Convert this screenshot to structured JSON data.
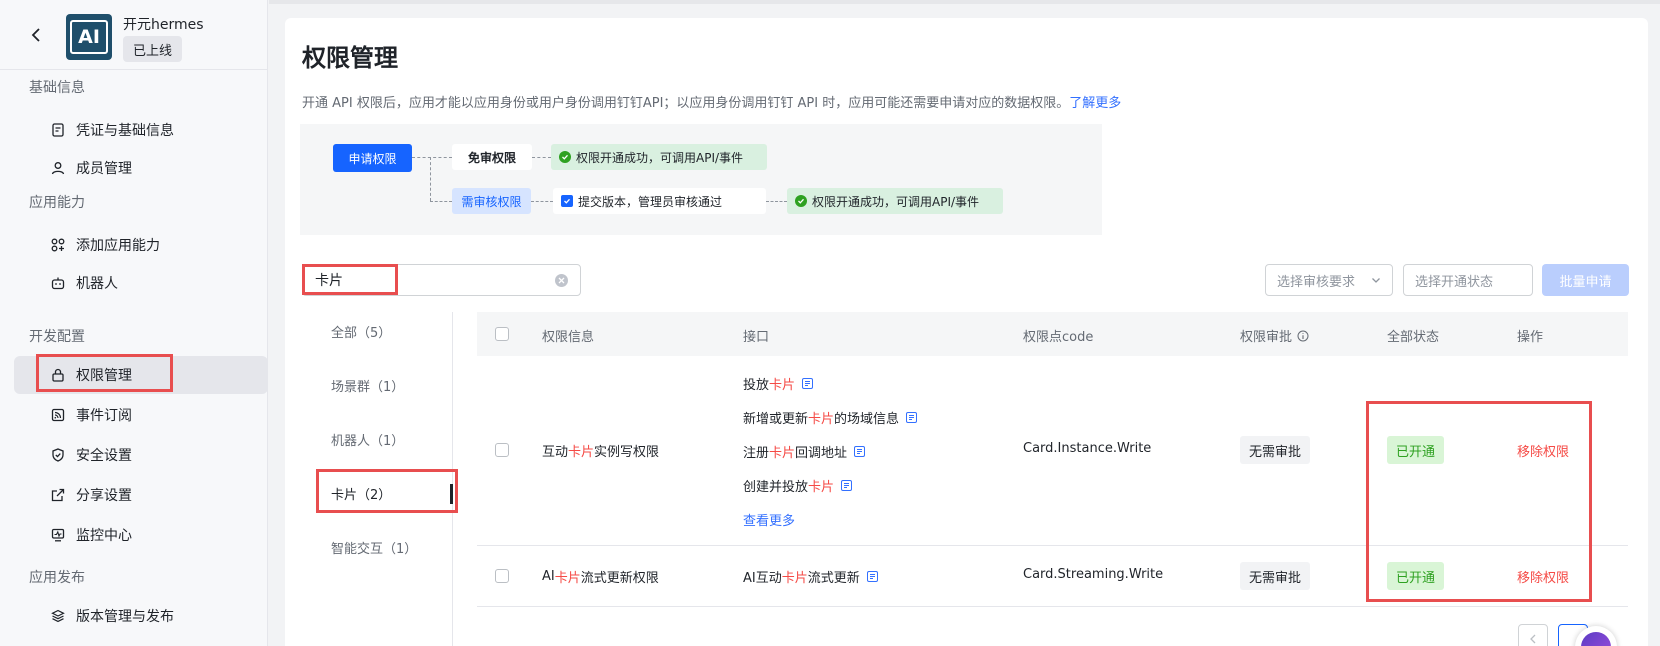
{
  "app": {
    "name": "开元hermes",
    "status": "已上线",
    "logo_text": "AI"
  },
  "sidebar": {
    "groups": [
      {
        "label": "基础信息",
        "items": [
          {
            "label": "凭证与基础信息",
            "icon": "credential-icon"
          },
          {
            "label": "成员管理",
            "icon": "user-icon"
          }
        ]
      },
      {
        "label": "应用能力",
        "items": [
          {
            "label": "添加应用能力",
            "icon": "add-capability-icon"
          },
          {
            "label": "机器人",
            "icon": "robot-icon"
          }
        ]
      },
      {
        "label": "开发配置",
        "items": [
          {
            "label": "权限管理",
            "icon": "lock-icon",
            "active": true
          },
          {
            "label": "事件订阅",
            "icon": "rss-icon"
          },
          {
            "label": "安全设置",
            "icon": "shield-icon"
          },
          {
            "label": "分享设置",
            "icon": "share-icon"
          },
          {
            "label": "监控中心",
            "icon": "monitor-icon"
          }
        ]
      },
      {
        "label": "应用发布",
        "items": [
          {
            "label": "版本管理与发布",
            "icon": "layers-icon"
          }
        ]
      }
    ]
  },
  "page": {
    "title": "权限管理",
    "description": "开通 API 权限后，应用才能以应用身份或用户身份调用钉钉API；以应用身份调用钉钉 API 时，应用可能还需要申请对应的数据权限。",
    "learn_more": "了解更多"
  },
  "flow": {
    "apply": "申请权限",
    "free": "免审权限",
    "review": "需审核权限",
    "success": "权限开通成功，可调用API/事件",
    "submit": "提交版本，管理员审核通过"
  },
  "toolbar": {
    "search_value": "卡片",
    "review_select_placeholder": "选择审核要求",
    "status_select_placeholder": "选择开通状态",
    "batch_apply": "批量申请"
  },
  "categories": [
    {
      "label": "全部（5）"
    },
    {
      "label": "场景群（1）"
    },
    {
      "label": "机器人（1）"
    },
    {
      "label": "卡片（2）",
      "active": true
    },
    {
      "label": "智能交互（1）"
    }
  ],
  "table": {
    "columns": [
      "权限信息",
      "接口",
      "权限点code",
      "权限审批",
      "全部状态",
      "操作"
    ],
    "rows": [
      {
        "name_parts": [
          "互动",
          "卡片",
          "实例写权限"
        ],
        "apis": [
          [
            "投放",
            "卡片",
            ""
          ],
          [
            "新增或更新",
            "卡片",
            "的场域信息"
          ],
          [
            "注册",
            "卡片",
            "回调地址"
          ],
          [
            "创建并投放",
            "卡片",
            ""
          ]
        ],
        "more": "查看更多",
        "code": "Card.Instance.Write",
        "approval": "无需审批",
        "status": "已开通",
        "action": "移除权限"
      },
      {
        "name_parts": [
          "AI",
          "卡片",
          "流式更新权限"
        ],
        "apis": [
          [
            "AI互动",
            "卡片",
            "流式更新"
          ]
        ],
        "code": "Card.Streaming.Write",
        "approval": "无需审批",
        "status": "已开通",
        "action": "移除权限"
      }
    ]
  },
  "colors": {
    "accent": "#1664ff",
    "highlight": "#f54a45",
    "success": "#2ea121",
    "annotation": "#e84e4f"
  }
}
